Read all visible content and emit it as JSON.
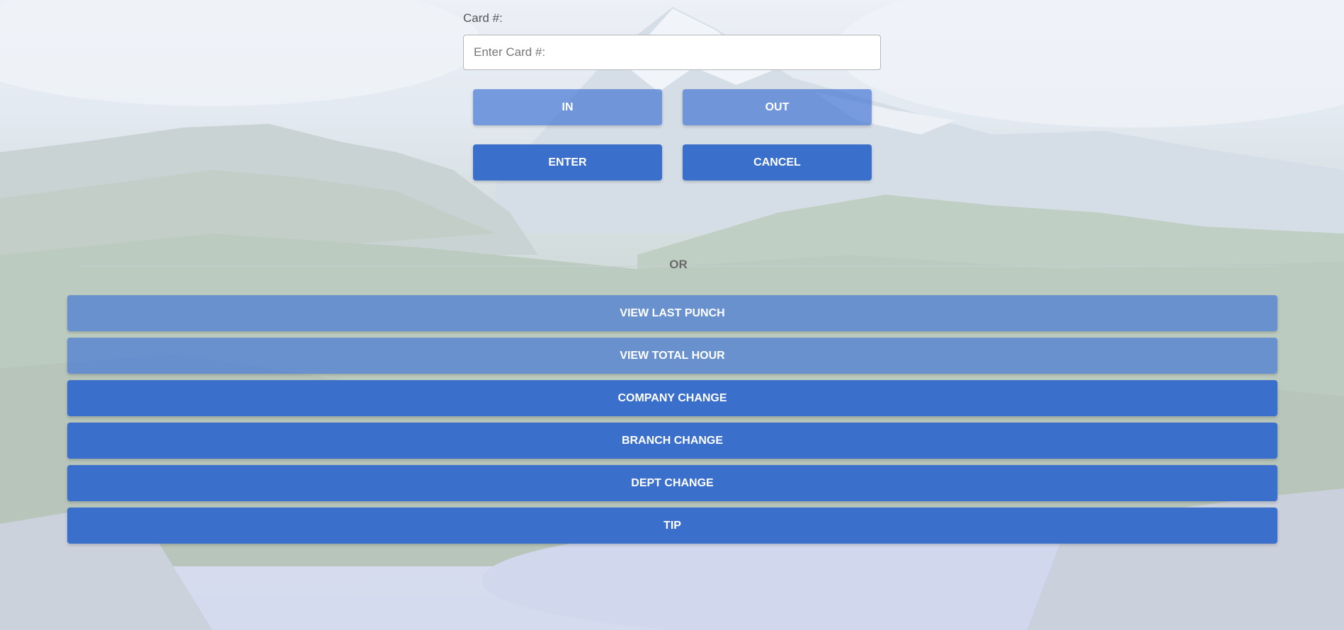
{
  "form": {
    "card_label": "Card #:",
    "card_placeholder": "Enter Card #:",
    "card_value": ""
  },
  "punch_buttons": {
    "in_label": "IN",
    "out_label": "OUT",
    "enter_label": "ENTER",
    "cancel_label": "CANCEL"
  },
  "divider": {
    "text": "OR"
  },
  "actions": {
    "view_last_punch": "VIEW LAST PUNCH",
    "view_total_hour": "VIEW TOTAL HOUR",
    "company_change": "COMPANY CHANGE",
    "branch_change": "BRANCH CHANGE",
    "dept_change": "DEPT CHANGE",
    "tip": "TIP"
  },
  "colors": {
    "button_solid": "#3a6fcb",
    "button_faded": "#4a7ad4",
    "text_label": "#555555"
  }
}
